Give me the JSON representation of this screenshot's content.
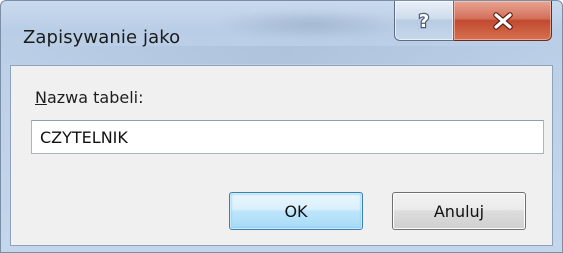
{
  "window": {
    "title": "Zapisywanie jako"
  },
  "titlebar": {
    "help_symbol": "?",
    "close_icon": "close-icon",
    "help_icon": "question-mark-icon"
  },
  "form": {
    "label_mnemonic": "N",
    "label_rest": "azwa tabeli:",
    "table_name_value": "CZYTELNIK"
  },
  "buttons": {
    "ok_label": "OK",
    "cancel_label": "Anuluj"
  },
  "colors": {
    "close_button": "#c24a30",
    "ok_button_border": "#3c7fb1",
    "frame": "#bcd0e8"
  }
}
